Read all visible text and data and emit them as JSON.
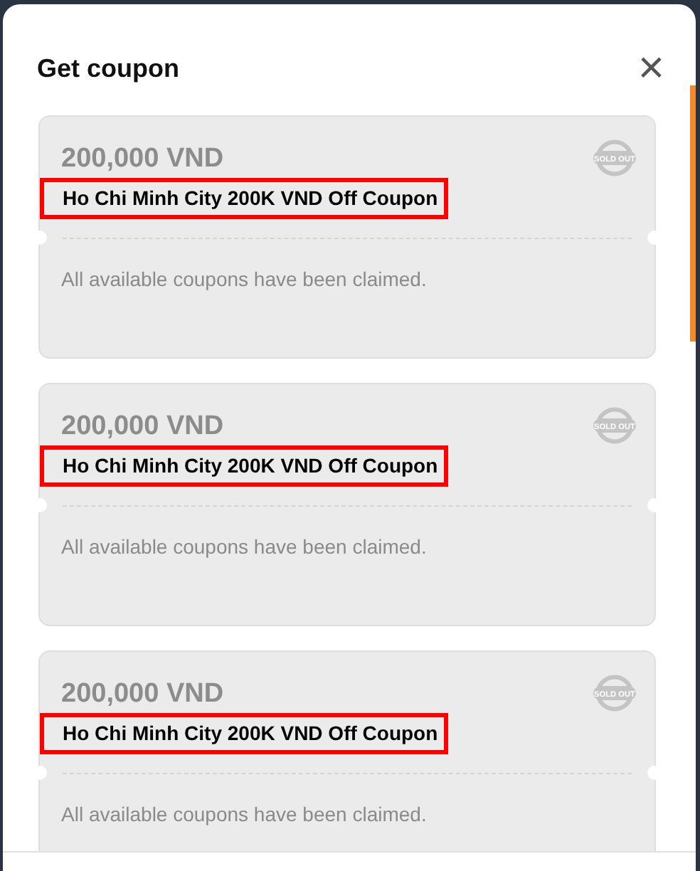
{
  "dialog": {
    "title": "Get coupon",
    "close": "×"
  },
  "coupons": [
    {
      "amount": "200,000 VND",
      "title": "Ho Chi Minh City 200K VND Off Coupon",
      "highlighted": true,
      "sold_out": true,
      "stamp": "SOLD OUT",
      "message": "All available coupons have been claimed."
    },
    {
      "amount": "200,000 VND",
      "title": "Ho Chi Minh City 200K VND Off Coupon",
      "highlighted": true,
      "sold_out": true,
      "stamp": "SOLD OUT",
      "message": "All available coupons have been claimed."
    },
    {
      "amount": "200,000 VND",
      "title": "Ho Chi Minh City 200K VND Off Coupon",
      "highlighted": true,
      "sold_out": true,
      "stamp": "SOLD OUT",
      "message": "All available coupons have been claimed."
    }
  ]
}
